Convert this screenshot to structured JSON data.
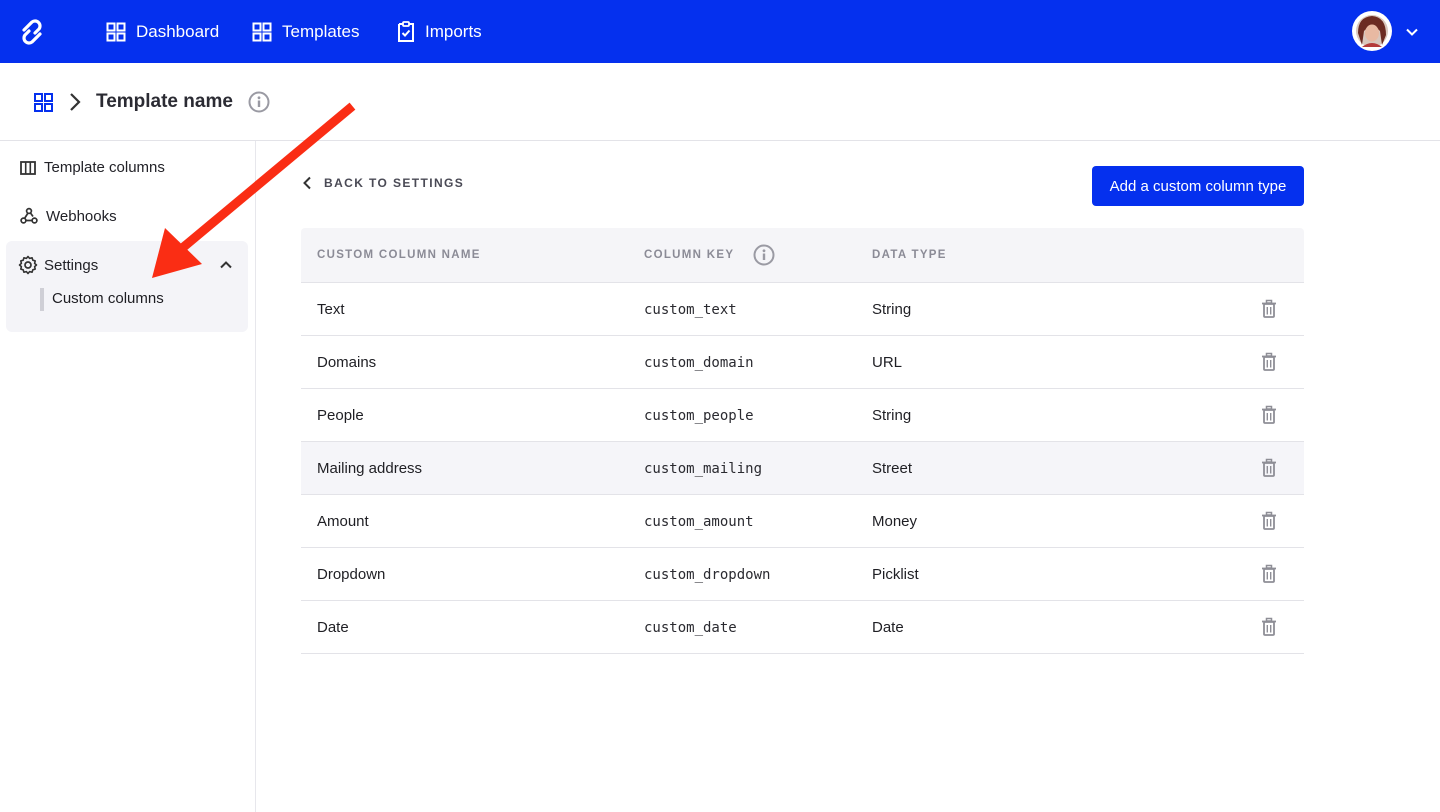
{
  "topnav": {
    "items": [
      {
        "label": "Dashboard",
        "icon": "grid-icon"
      },
      {
        "label": "Templates",
        "icon": "grid-icon"
      },
      {
        "label": "Imports",
        "icon": "clipboard-check-icon"
      }
    ],
    "brand_color": "#0530ee"
  },
  "header": {
    "title": "Template name"
  },
  "sidebar": {
    "items": [
      {
        "label": "Template columns",
        "icon": "columns-icon"
      },
      {
        "label": "Webhooks",
        "icon": "webhook-icon"
      },
      {
        "label": "Settings",
        "icon": "gear-icon",
        "expanded": true,
        "children": [
          {
            "label": "Custom columns",
            "active": true
          }
        ]
      }
    ]
  },
  "main": {
    "back_label": "BACK TO SETTINGS",
    "add_button": "Add a custom column type",
    "table": {
      "headers": [
        "CUSTOM COLUMN NAME",
        "COLUMN KEY",
        "DATA TYPE"
      ],
      "rows": [
        {
          "name": "Text",
          "key": "custom_text",
          "type": "String"
        },
        {
          "name": "Domains",
          "key": "custom_domain",
          "type": "URL"
        },
        {
          "name": "People",
          "key": "custom_people",
          "type": "String"
        },
        {
          "name": "Mailing address",
          "key": "custom_mailing",
          "type": "Street"
        },
        {
          "name": "Amount",
          "key": "custom_amount",
          "type": "Money"
        },
        {
          "name": "Dropdown",
          "key": "custom_dropdown",
          "type": "Picklist"
        },
        {
          "name": "Date",
          "key": "custom_date",
          "type": "Date"
        }
      ],
      "highlighted_row": 3
    }
  },
  "annotation": {
    "color": "#fa2d14",
    "points_to": "Custom columns"
  }
}
